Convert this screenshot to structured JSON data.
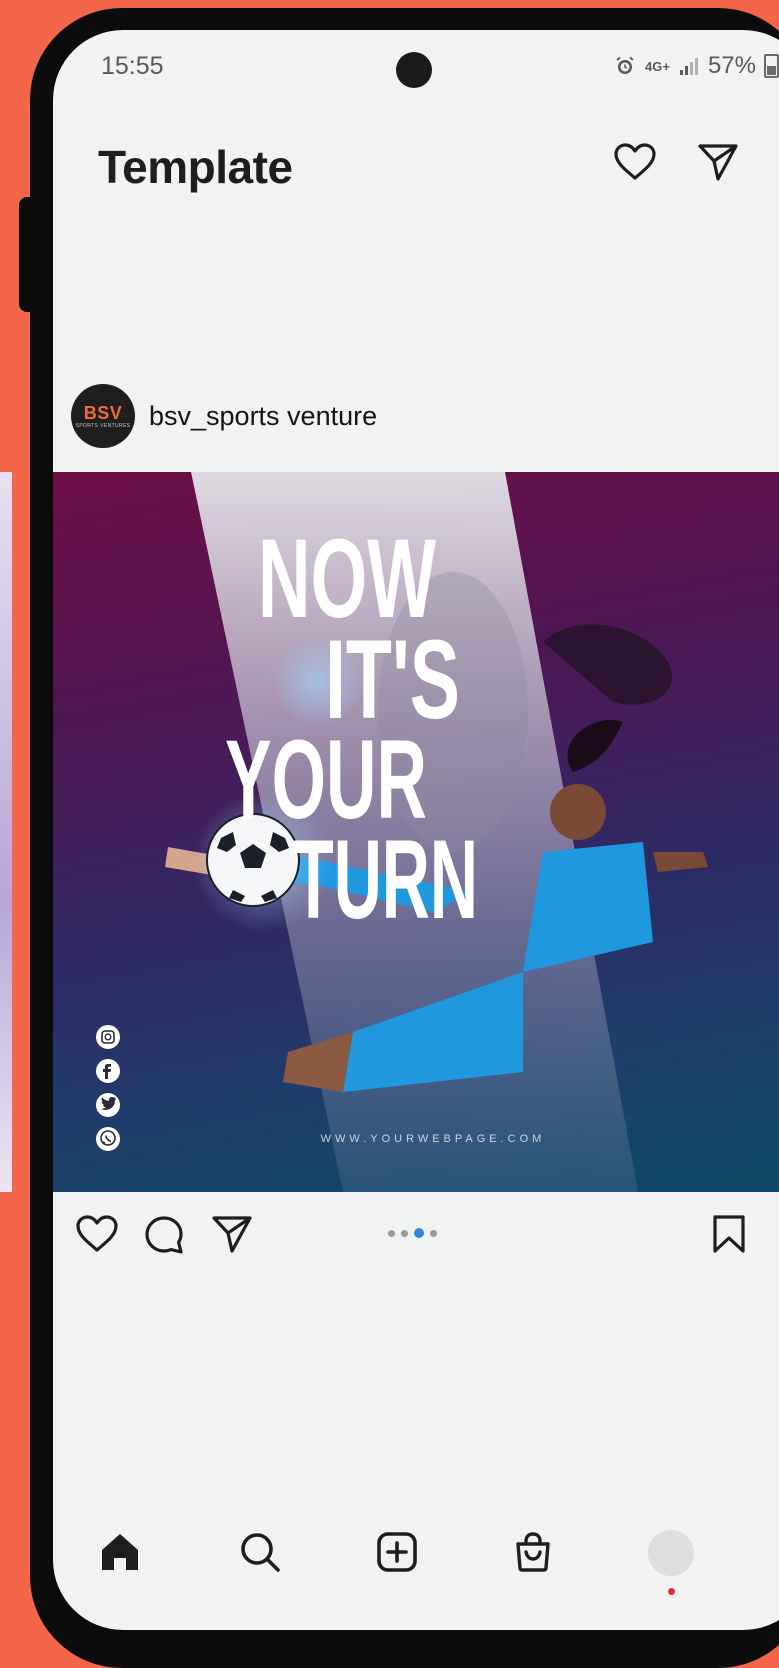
{
  "status_bar": {
    "time": "15:55",
    "network": "4G+",
    "battery": "57%"
  },
  "header": {
    "title": "Template",
    "icons": [
      "heart-icon",
      "send-icon"
    ]
  },
  "post": {
    "username": "bsv_sports venture",
    "avatar": {
      "logo_text": "BSV",
      "subtitle": "SPORTS VENTURES"
    },
    "image": {
      "headline": [
        "NOW",
        "IT'S",
        "YOUR",
        "TURN"
      ],
      "website": "WWW.YOURWEBPAGE.COM",
      "social_icons": [
        "instagram-icon",
        "facebook-icon",
        "twitter-icon",
        "whatsapp-icon"
      ]
    },
    "carousel": {
      "count": 4,
      "active_index": 2
    },
    "actions": [
      "like-icon",
      "comment-icon",
      "share-icon",
      "bookmark-icon"
    ]
  },
  "bottom_nav": {
    "items": [
      "home-icon",
      "search-icon",
      "create-icon",
      "shop-icon",
      "profile-avatar"
    ]
  },
  "colors": {
    "background": "#f4664a",
    "screen": "#f1f3f2",
    "accent_blue": "#2b86e0",
    "notification": "#e0303b",
    "brand_orange": "#f06a3c"
  }
}
